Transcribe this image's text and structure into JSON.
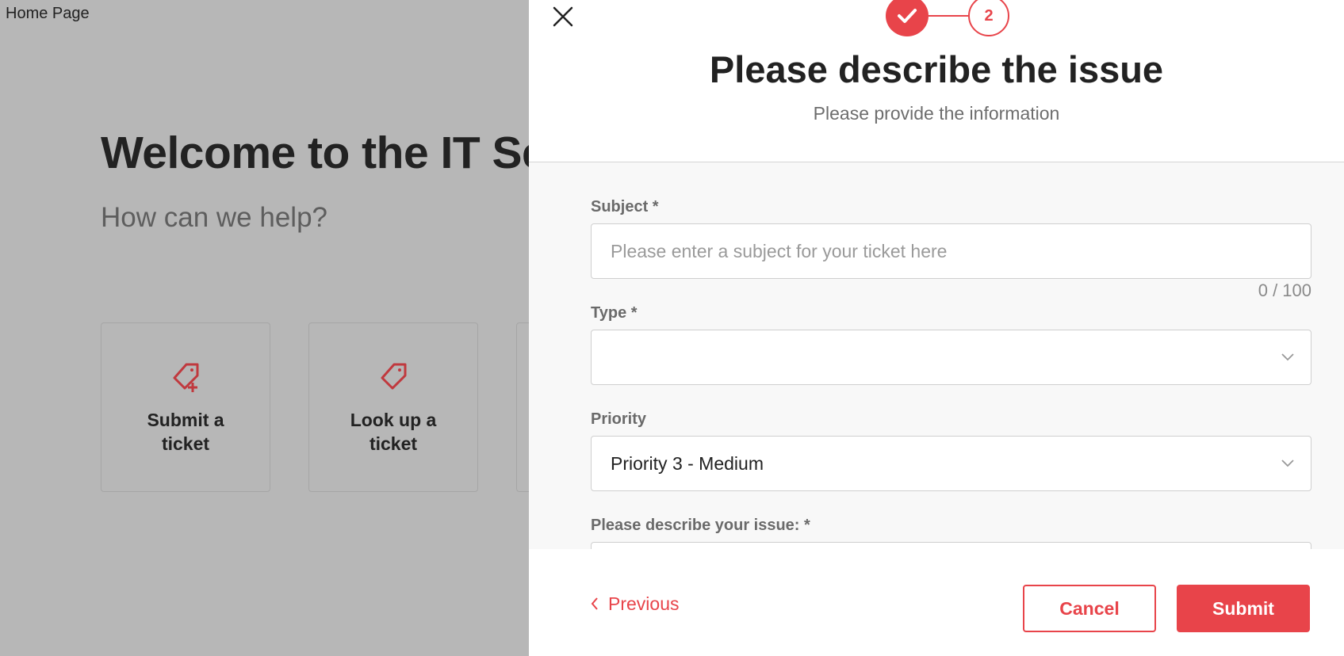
{
  "background": {
    "home_label": "Home Page",
    "welcome_title": "Welcome to the IT Serv",
    "subtitle": "How can we help?",
    "tiles": [
      {
        "label": "Submit a ticket",
        "icon": "tag-plus-icon"
      },
      {
        "label": "Look up a ticket",
        "icon": "tag-icon"
      }
    ]
  },
  "panel": {
    "close_icon": "close-icon",
    "stepper": {
      "step1_icon": "checkmark-icon",
      "step2_number": "2"
    },
    "title": "Please describe the issue",
    "subtitle": "Please provide the information",
    "fields": {
      "subject": {
        "label": "Subject *",
        "placeholder": "Please enter a subject for your ticket here",
        "value": "",
        "counter": "0 / 100"
      },
      "type": {
        "label": "Type *",
        "value": ""
      },
      "priority": {
        "label": "Priority",
        "value": "Priority 3 - Medium"
      },
      "description": {
        "label": "Please describe your issue: *"
      }
    },
    "footer": {
      "previous_label": "Previous",
      "cancel_label": "Cancel",
      "submit_label": "Submit"
    }
  },
  "colors": {
    "accent": "#e8444a",
    "overlay_bg": "#b7b7b7",
    "form_bg": "#f8f8f8"
  }
}
